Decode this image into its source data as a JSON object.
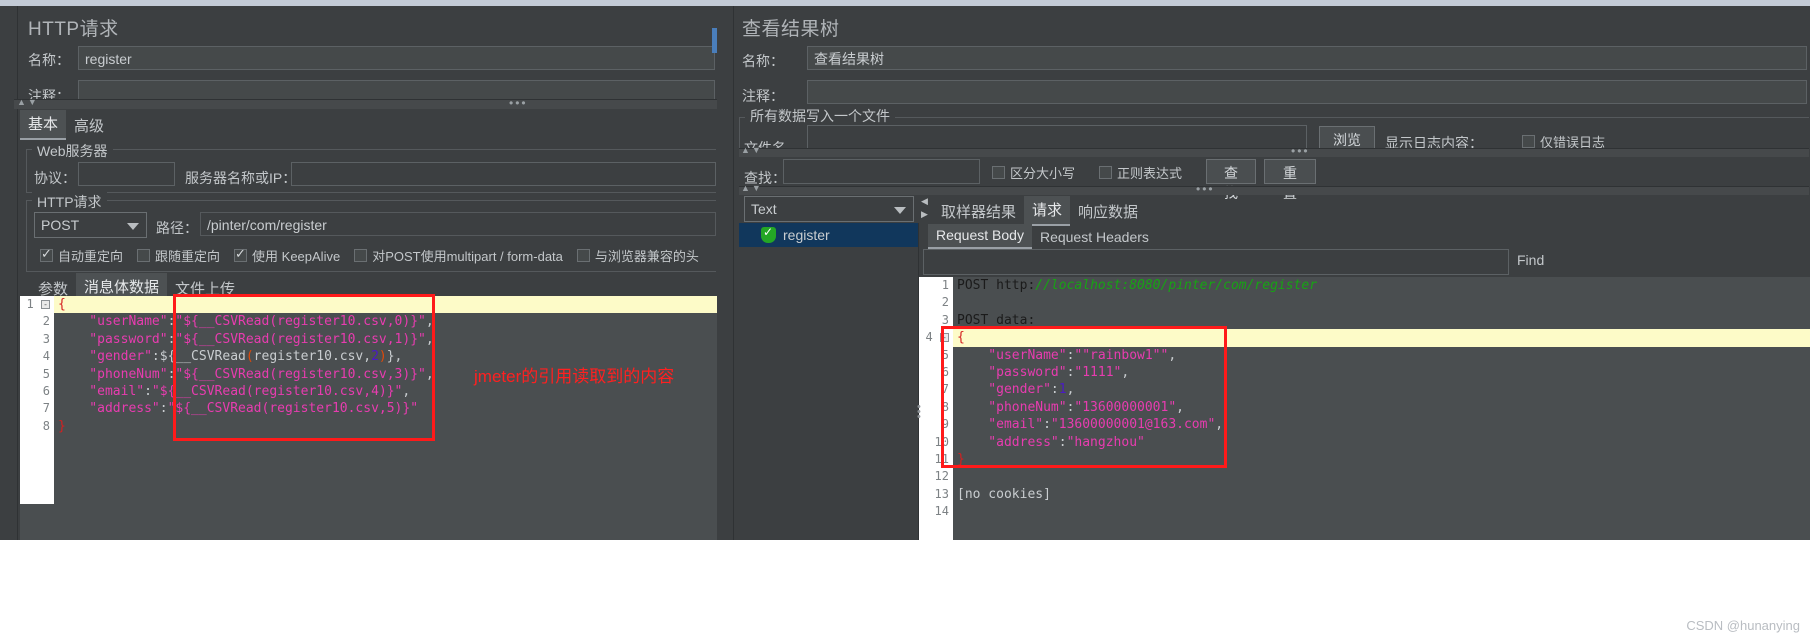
{
  "left_panel": {
    "title": "HTTP请求",
    "name_label": "名称：",
    "name_value": "register",
    "comment_label": "注释：",
    "comment_value": "",
    "tabs": [
      {
        "label": "基本",
        "selected": true
      },
      {
        "label": "高级",
        "selected": false
      }
    ],
    "web_server": {
      "group_label": "Web服务器",
      "protocol_label": "协议：",
      "protocol_value": "",
      "server_label": "服务器名称或IP：",
      "server_value": ""
    },
    "http_request": {
      "group_label": "HTTP请求",
      "method": "POST",
      "path_label": "路径：",
      "path_value": "/pinter/com/register",
      "checkboxes": [
        {
          "label": "自动重定向",
          "checked": true
        },
        {
          "label": "跟随重定向",
          "checked": false
        },
        {
          "label": "使用 KeepAlive",
          "checked": true
        },
        {
          "label": "对POST使用multipart / form-data",
          "checked": false
        },
        {
          "label": "与浏览器兼容的头",
          "checked": false
        }
      ]
    },
    "body_tabs": [
      {
        "label": "参数",
        "selected": false
      },
      {
        "label": "消息体数据",
        "selected": true
      },
      {
        "label": "文件上传",
        "selected": false
      }
    ],
    "code_lines": [
      {
        "n": "1",
        "fold": true,
        "highlight": true,
        "tokens": [
          {
            "t": "{",
            "c": "red"
          }
        ]
      },
      {
        "n": "2",
        "fold": false,
        "highlight": false,
        "tokens": [
          {
            "t": "    \"userName\"",
            "c": "k"
          },
          {
            "t": ":",
            "c": "pl"
          },
          {
            "t": "\"${__CSVRead(register10.csv,0)}\"",
            "c": "k"
          },
          {
            "t": ",",
            "c": "pl"
          }
        ]
      },
      {
        "n": "3",
        "fold": false,
        "highlight": false,
        "tokens": [
          {
            "t": "    \"password\"",
            "c": "k"
          },
          {
            "t": ":",
            "c": "pl"
          },
          {
            "t": "\"${__CSVRead(register10.csv,1)}\"",
            "c": "k"
          },
          {
            "t": ",",
            "c": "pl"
          }
        ]
      },
      {
        "n": "4",
        "fold": false,
        "highlight": false,
        "tokens": [
          {
            "t": "    \"gender\"",
            "c": "k"
          },
          {
            "t": ":",
            "c": "pl"
          },
          {
            "t": "${__CSVRead",
            "c": "pl"
          },
          {
            "t": "(",
            "c": "par"
          },
          {
            "t": "register10.csv,",
            "c": "pl"
          },
          {
            "t": "2",
            "c": "num"
          },
          {
            "t": ")",
            "c": "par"
          },
          {
            "t": "},",
            "c": "pl"
          }
        ]
      },
      {
        "n": "5",
        "fold": false,
        "highlight": false,
        "tokens": [
          {
            "t": "    \"phoneNum\"",
            "c": "k"
          },
          {
            "t": ":",
            "c": "pl"
          },
          {
            "t": "\"${__CSVRead(register10.csv,3)}\"",
            "c": "k"
          },
          {
            "t": ",",
            "c": "pl"
          }
        ]
      },
      {
        "n": "6",
        "fold": false,
        "highlight": false,
        "tokens": [
          {
            "t": "    \"email\"",
            "c": "k"
          },
          {
            "t": ":",
            "c": "pl"
          },
          {
            "t": "\"${__CSVRead(register10.csv,4)}\"",
            "c": "k"
          },
          {
            "t": ",",
            "c": "pl"
          }
        ]
      },
      {
        "n": "7",
        "fold": false,
        "highlight": false,
        "tokens": [
          {
            "t": "    \"address\"",
            "c": "k"
          },
          {
            "t": ":",
            "c": "pl"
          },
          {
            "t": "\"${__CSVRead(register10.csv,5)}\"",
            "c": "k"
          }
        ]
      },
      {
        "n": "8",
        "fold": false,
        "highlight": false,
        "tokens": [
          {
            "t": "}",
            "c": "red"
          }
        ]
      }
    ]
  },
  "annotation": {
    "text": "jmeter的引用读取到的内容",
    "color": "#ff2020"
  },
  "right_panel": {
    "title": "查看结果树",
    "name_label": "名称：",
    "name_value": "查看结果树",
    "comment_label": "注释：",
    "comment_value": "",
    "file_group_label": "所有数据写入一个文件",
    "filename_label": "文件名",
    "filename_value": "",
    "browse_button": "浏览",
    "log_display_label": "显示日志内容：",
    "error_only_checkbox": "仅错误日志",
    "search_label": "查找：",
    "search_value": "",
    "case_sensitive_checkbox": "区分大小写",
    "regex_checkbox": "正则表达式",
    "find_button": "查找",
    "reset_button": "重置",
    "renderer_select": "Text",
    "tree_item": "register",
    "result_tabs": [
      {
        "label": "取样器结果",
        "selected": false
      },
      {
        "label": "请求",
        "selected": true
      },
      {
        "label": "响应数据",
        "selected": false
      }
    ],
    "sub_tabs": [
      {
        "label": "Request Body",
        "selected": true
      },
      {
        "label": "Request Headers",
        "selected": false
      }
    ],
    "find_field_value": "",
    "find_button_right": "Find",
    "code_lines": [
      {
        "n": "1",
        "fold": false,
        "highlight": false,
        "tokens": [
          {
            "t": "POST http",
            "c": "pd"
          },
          {
            "t": ":",
            "c": "pd"
          },
          {
            "t": "//localhost:8080/pinter/com/register",
            "c": "grn"
          }
        ]
      },
      {
        "n": "2",
        "fold": false,
        "highlight": false,
        "tokens": []
      },
      {
        "n": "3",
        "fold": false,
        "highlight": false,
        "tokens": [
          {
            "t": "POST data",
            "c": "pd"
          },
          {
            "t": ":",
            "c": "pd"
          }
        ]
      },
      {
        "n": "4",
        "fold": true,
        "highlight": true,
        "tokens": [
          {
            "t": "{",
            "c": "red"
          }
        ]
      },
      {
        "n": "5",
        "fold": false,
        "highlight": false,
        "tokens": [
          {
            "t": "    \"userName\"",
            "c": "k"
          },
          {
            "t": ":",
            "c": "pl"
          },
          {
            "t": "\"\"rainbow1\"\"",
            "c": "k"
          },
          {
            "t": ",",
            "c": "pl"
          }
        ]
      },
      {
        "n": "6",
        "fold": false,
        "highlight": false,
        "tokens": [
          {
            "t": "    \"password\"",
            "c": "k"
          },
          {
            "t": ":",
            "c": "pl"
          },
          {
            "t": "\"1111\"",
            "c": "k"
          },
          {
            "t": ",",
            "c": "pl"
          }
        ]
      },
      {
        "n": "7",
        "fold": false,
        "highlight": false,
        "tokens": [
          {
            "t": "    \"gender\"",
            "c": "k"
          },
          {
            "t": ":",
            "c": "pl"
          },
          {
            "t": "1",
            "c": "num"
          },
          {
            "t": ",",
            "c": "pl"
          }
        ]
      },
      {
        "n": "8",
        "fold": false,
        "highlight": false,
        "tokens": [
          {
            "t": "    \"phoneNum\"",
            "c": "k"
          },
          {
            "t": ":",
            "c": "pl"
          },
          {
            "t": "\"13600000001\"",
            "c": "k"
          },
          {
            "t": ",",
            "c": "pl"
          }
        ]
      },
      {
        "n": "9",
        "fold": false,
        "highlight": false,
        "tokens": [
          {
            "t": "    \"email\"",
            "c": "k"
          },
          {
            "t": ":",
            "c": "pl"
          },
          {
            "t": "\"13600000001@163.com\"",
            "c": "k"
          },
          {
            "t": ",",
            "c": "pl"
          }
        ]
      },
      {
        "n": "10",
        "fold": false,
        "highlight": false,
        "tokens": [
          {
            "t": "    \"address\"",
            "c": "k"
          },
          {
            "t": ":",
            "c": "pl"
          },
          {
            "t": "\"hangzhou\"",
            "c": "k"
          }
        ]
      },
      {
        "n": "11",
        "fold": false,
        "highlight": false,
        "tokens": [
          {
            "t": "}",
            "c": "red"
          }
        ]
      },
      {
        "n": "12",
        "fold": false,
        "highlight": false,
        "tokens": []
      },
      {
        "n": "13",
        "fold": false,
        "highlight": false,
        "tokens": [
          {
            "t": "[no cookies]",
            "c": "pl"
          }
        ]
      },
      {
        "n": "14",
        "fold": false,
        "highlight": false,
        "tokens": []
      }
    ]
  },
  "watermark": "CSDN @hunanying"
}
